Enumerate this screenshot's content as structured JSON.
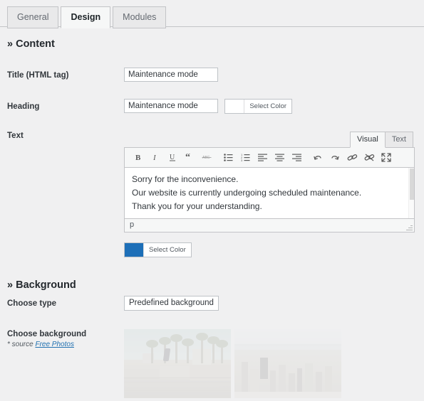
{
  "tabs": [
    {
      "label": "General",
      "active": false
    },
    {
      "label": "Design",
      "active": true
    },
    {
      "label": "Modules",
      "active": false
    }
  ],
  "sections": {
    "content": {
      "title": "» Content"
    },
    "background": {
      "title": "» Background"
    }
  },
  "fields": {
    "title": {
      "label": "Title (HTML tag)",
      "value": "Maintenance mode"
    },
    "heading": {
      "label": "Heading",
      "value": "Maintenance mode",
      "color_button": "Select Color",
      "color_value": "#ffffff"
    },
    "text": {
      "label": "Text",
      "editor_tabs": [
        {
          "label": "Visual",
          "active": true
        },
        {
          "label": "Text",
          "active": false
        }
      ],
      "toolbar": [
        "bold-icon",
        "italic-icon",
        "underline-icon",
        "blockquote-icon",
        "strikethrough-icon",
        "bulleted-list-icon",
        "numbered-list-icon",
        "align-left-icon",
        "align-center-icon",
        "align-right-icon",
        "undo-icon",
        "redo-icon",
        "insert-link-icon",
        "remove-link-icon",
        "fullscreen-icon"
      ],
      "body_lines": [
        "Sorry for the inconvenience.",
        "Our website is currently undergoing scheduled maintenance.",
        "Thank you for your understanding."
      ],
      "status_path": "p",
      "color_button": "Select Color",
      "color_value": "#1d6fb8"
    },
    "choose_type": {
      "label": "Choose type",
      "value": "Predefined background"
    },
    "choose_background": {
      "label": "Choose background",
      "source_prefix": "* source ",
      "source_link": "Free Photos",
      "thumbnails": [
        {
          "alt": "skate-park-palm-trees-photo"
        },
        {
          "alt": "aerial-cityscape-photo"
        }
      ]
    }
  },
  "colors": {
    "page_background": "#f0f0f1",
    "accent_blue": "#1d6fb8",
    "link_blue": "#2271b1",
    "border": "#c3c4c7"
  }
}
